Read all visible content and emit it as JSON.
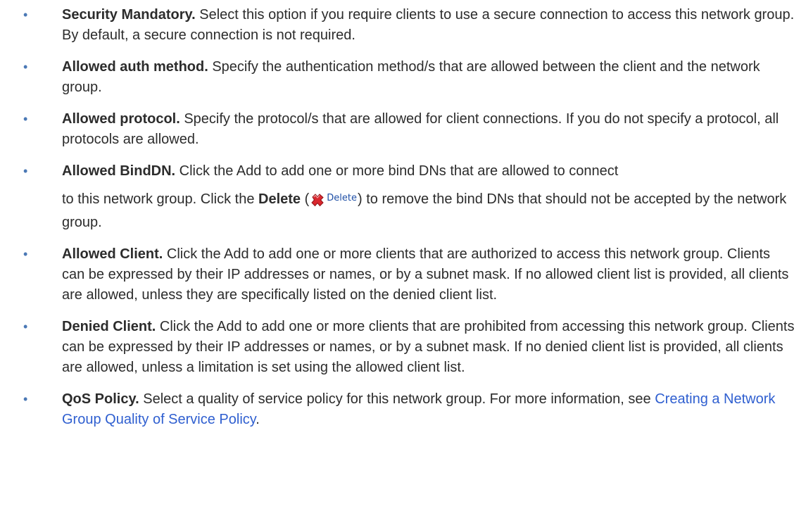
{
  "bullet_glyph": "•",
  "colors": {
    "bullet": "#4a78b5",
    "text": "#2c2c2c",
    "link": "#2f5fd0",
    "delete_icon": "#d9272e"
  },
  "items": [
    {
      "term": "Security Mandatory.",
      "text": " Select this option if you require clients to use a secure connection to access this network group. By default, a secure connection is not required."
    },
    {
      "term": "Allowed auth method.",
      "text": " Specify the authentication method/s that are allowed between the client and the network group."
    },
    {
      "term": "Allowed protocol.",
      "text": " Specify the protocol/s that are allowed for client connections. If you do not specify a protocol, all protocols are allowed."
    },
    {
      "term": "Allowed BindDN.",
      "text_before_break": " Click the Add to add one or more bind DNs that are allowed to connect",
      "text_after_break": "to this network group. Click the ",
      "bold_inline": "Delete",
      "paren_open": " (",
      "delete_icon_label": "Delete",
      "delete_icon_name": "red-x-delete-icon",
      "paren_close_text": ") to remove the bind DNs that should not be accepted by the network group."
    },
    {
      "term": "Allowed Client.",
      "text": " Click the Add to add one or more clients that are authorized to access this network group. Clients can be expressed by their IP addresses or names, or by a subnet mask. If no allowed client list is provided, all clients are allowed, unless they are specifically listed on the denied client list."
    },
    {
      "term": "Denied Client.",
      "text": " Click the Add to add one or more clients that are prohibited from accessing this network group. Clients can be expressed by their IP addresses or names, or by a subnet mask. If no denied client list is provided, all clients are allowed, unless a limitation is set using the allowed client list."
    },
    {
      "term": "QoS Policy.",
      "text": " Select a quality of service policy for this network group. For more information, see ",
      "link_text": "Creating a Network Group Quality of Service Policy",
      "text_after_link": "."
    }
  ]
}
